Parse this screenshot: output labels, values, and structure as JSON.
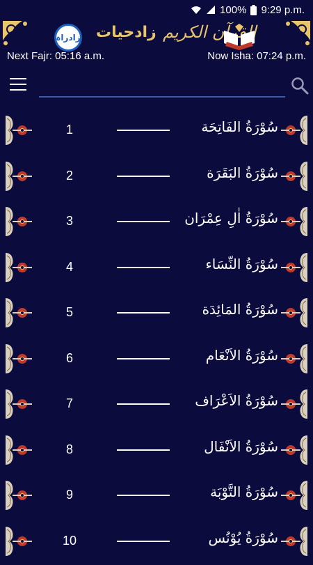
{
  "status_bar": {
    "battery": "100%",
    "time": "9:29 p.m."
  },
  "header": {
    "logo_text": "زادراہ",
    "app_title": "زادحیات",
    "quran_title": "القرآن الكريم"
  },
  "prayer": {
    "next": "Next Fajr: 05:16 a.m.",
    "now": "Now Isha: 07:24 p.m."
  },
  "search": {
    "value": "",
    "placeholder": ""
  },
  "surahs": [
    {
      "number": "1",
      "name": "سُوْرَةُ الفَاتِحَة"
    },
    {
      "number": "2",
      "name": "سُوْرَةُ البَقَرَة"
    },
    {
      "number": "3",
      "name": "سُوْرَةُ اٰلِ عِمْرَان"
    },
    {
      "number": "4",
      "name": "سُوْرَةُ النِّسَاء"
    },
    {
      "number": "5",
      "name": "سُوْرَةُ المَائِدَة"
    },
    {
      "number": "6",
      "name": "سُوْرَةُ الاَنْعَام"
    },
    {
      "number": "7",
      "name": "سُوْرَةُ الاَعْرَاف"
    },
    {
      "number": "8",
      "name": "سُوْرَةُ الاَنْفَال"
    },
    {
      "number": "9",
      "name": "سُوْرَةُ التَّوْبَة"
    },
    {
      "number": "10",
      "name": "سُوْرَةُ يُوْنُس"
    }
  ],
  "colors": {
    "background": "#0b0b3e",
    "gold": "#e8c46a",
    "accent_blue": "#3b5aa8",
    "ornament_red": "#c0392b"
  },
  "icons": {
    "menu": "hamburger-menu-icon",
    "search": "search-icon",
    "wifi": "wifi-icon",
    "signal": "signal-icon",
    "battery": "battery-icon",
    "ornament": "ornament-icon"
  }
}
